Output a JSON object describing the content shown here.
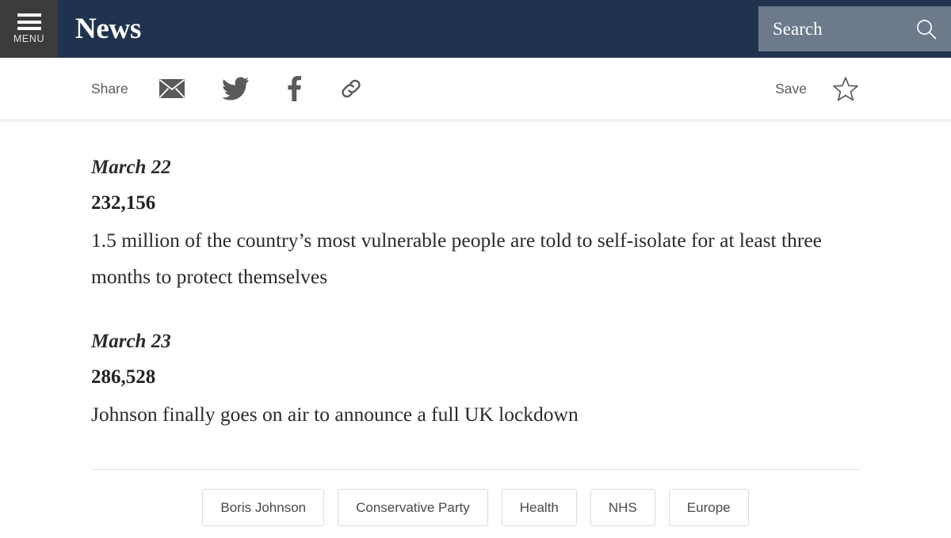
{
  "header": {
    "menu_label": "MENU",
    "menu_icon": "hamburger-icon",
    "brand_title": "News",
    "search": {
      "placeholder": "Search",
      "value": "Search",
      "icon": "search-icon"
    },
    "colors": {
      "bar_background": "#20334e",
      "menu_background": "#3b3b3b",
      "search_background": "#6d7a8c"
    }
  },
  "share_bar": {
    "share_label": "Share",
    "save_label": "Save",
    "icons": [
      {
        "name": "email-icon",
        "title": "Email"
      },
      {
        "name": "twitter-icon",
        "title": "Twitter"
      },
      {
        "name": "facebook-icon",
        "title": "Facebook"
      },
      {
        "name": "link-icon",
        "title": "Copy link"
      }
    ],
    "save_icon": "star-icon"
  },
  "article": {
    "entries": [
      {
        "date": "March 22",
        "number": "232,156",
        "text": "1.5 million of the country’s most vulnerable people are told to self-isolate for at least three months to protect themselves"
      },
      {
        "date": "March 23",
        "number": "286,528",
        "text": "Johnson finally goes on air to announce a full UK lockdown"
      }
    ]
  },
  "tags": [
    {
      "label": "Boris Johnson"
    },
    {
      "label": "Conservative Party"
    },
    {
      "label": "Health"
    },
    {
      "label": "NHS"
    },
    {
      "label": "Europe"
    }
  ]
}
